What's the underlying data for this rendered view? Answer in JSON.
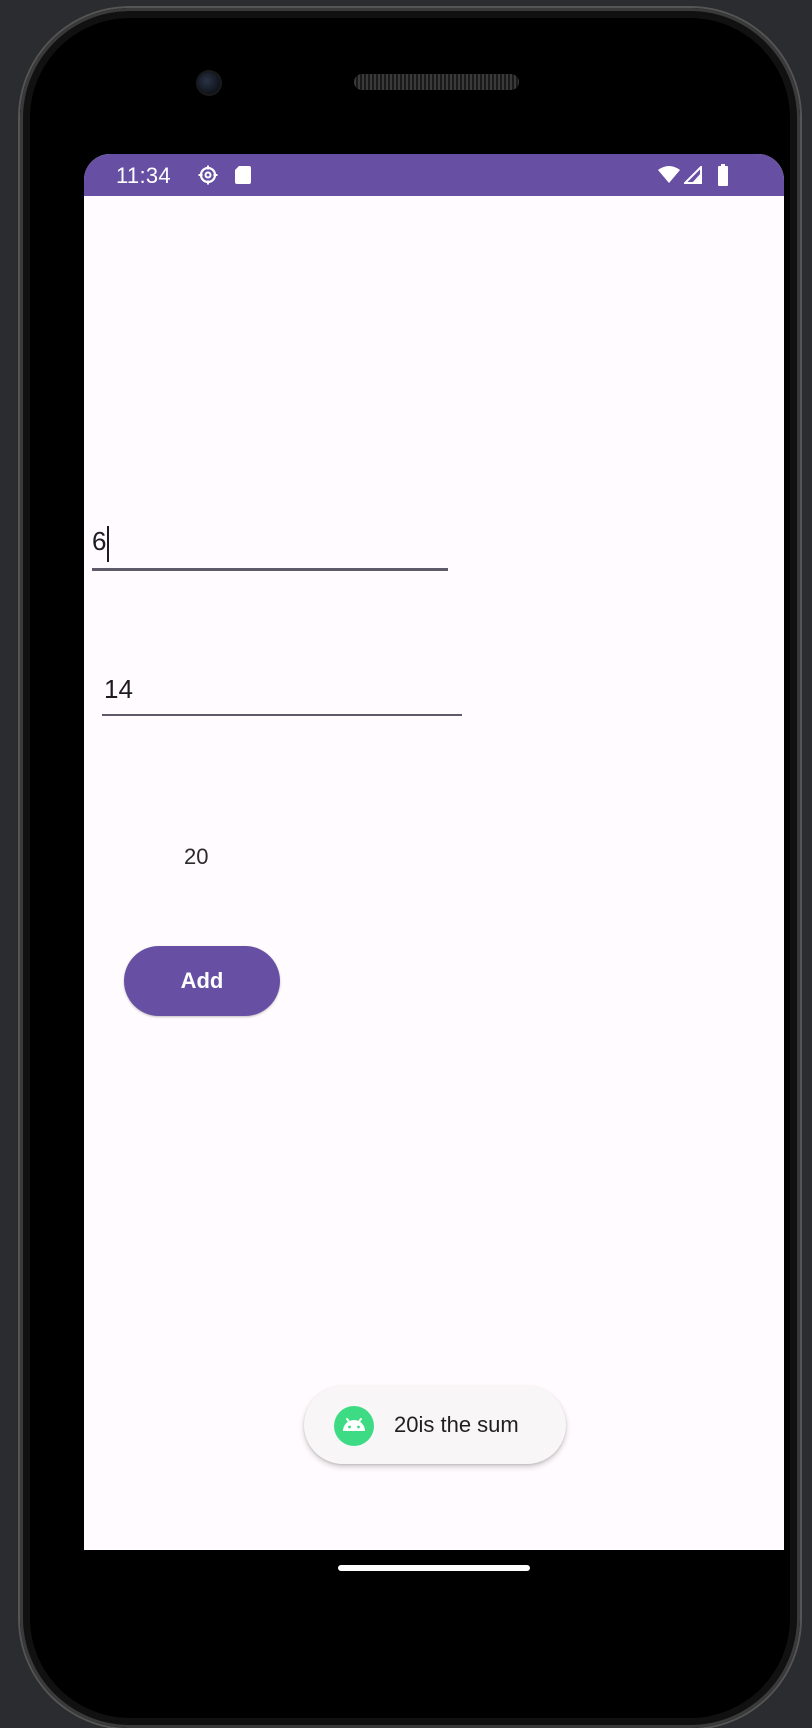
{
  "status_bar": {
    "time": "11:34",
    "background_color": "#6750a4",
    "icons": [
      "settings-gear-icon",
      "sd-card-icon",
      "wifi-icon",
      "cell-signal-icon",
      "battery-icon"
    ]
  },
  "form": {
    "first_number": "6",
    "second_number": "14",
    "result": "20"
  },
  "add_button": {
    "label": "Add",
    "color": "#6750a4"
  },
  "toast": {
    "message": "20is the sum",
    "icon": "android-app-icon",
    "icon_color": "#3ddc84"
  }
}
